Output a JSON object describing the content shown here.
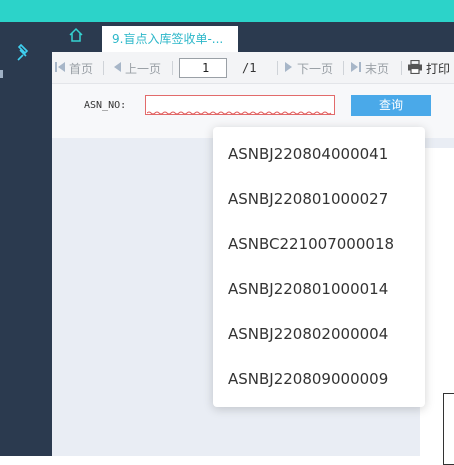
{
  "tabs": {
    "active_label": "9.盲点入库签收单-..."
  },
  "toolbar": {
    "first": "首页",
    "prev": "上一页",
    "page_value": "1",
    "total": "/1",
    "next": "下一页",
    "last": "末页",
    "print": "打印"
  },
  "query": {
    "label": "ASN_NO:",
    "input_value": "",
    "button": "查询"
  },
  "dropdown": {
    "items": [
      "ASNBJ220804000041",
      "ASNBJ220801000027",
      "ASNBC221007000018",
      "ASNBJ220801000014",
      "ASNBJ220802000004",
      "ASNBJ220809000009"
    ]
  },
  "colors": {
    "top_bar": "#2cd3c9",
    "sidebar": "#2b3a4f",
    "tab_text": "#2cb7c9",
    "query_button": "#4aa9e9",
    "input_error_border": "#e26b6b"
  },
  "icons": [
    "pin-icon",
    "home-icon",
    "first-page-icon",
    "prev-page-icon",
    "next-page-icon",
    "last-page-icon",
    "printer-icon"
  ]
}
